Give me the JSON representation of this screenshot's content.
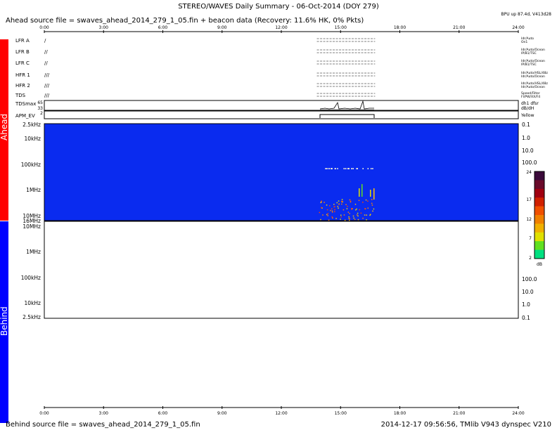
{
  "header": {
    "title": "STEREO/WAVES Daily Summary - 06-Oct-2014 (DOY 279)",
    "ahead_source": "Ahead source file = swaves_ahead_2014_279_1_05.fin + beacon data (Recovery: 11.6% HK,   0% Pkts)",
    "version_tag": "BPU up 87.4d, V413d28"
  },
  "footer": {
    "behind_source": "Behind source file = swaves_ahead_2014_279_1_05.fin",
    "timestamp": "2014-12-17 09:56:56, TMlib V943 dynspec V210"
  },
  "side_labels": {
    "ahead": "Ahead",
    "behind": "Behind",
    "ahead_color": "#ff0000",
    "behind_color": "#0000ff"
  },
  "time_axis": {
    "ticks": [
      "0:00",
      "3:00",
      "6:00",
      "9:00",
      "12:00",
      "15:00",
      "18:00",
      "21:00",
      "24:00"
    ],
    "data_start_hr": 13.8,
    "data_end_hr": 16.75
  },
  "hk_rows": [
    {
      "label": "LFR A",
      "marks": "/",
      "status_right": [
        "Idr/Auto",
        "On1"
      ]
    },
    {
      "label": "LFR B",
      "marks": "//",
      "status_right": [
        "Idr/Auto/Ocean",
        "IP/B1/TSC"
      ]
    },
    {
      "label": "LFR C",
      "marks": "//",
      "status_right": [
        "Idr/Auto/Ocean",
        "IP/B1/TSC"
      ]
    },
    {
      "label": "HFR 1",
      "marks": "///",
      "status_right": [
        "Idr/Auto/HSL/48z",
        "Idr/Auto/Ocean"
      ]
    },
    {
      "label": "HFR 2",
      "marks": "///",
      "status_right": [
        "Idr/Auto/HSL/48z",
        "Idr/Auto/Ocean"
      ]
    },
    {
      "label": "TDS",
      "marks": "///",
      "status_right": [
        "Speed/Filter",
        "Fl/PW/XX/F4"
      ]
    }
  ],
  "tds": {
    "label": "TDSmax",
    "y_ticks": [
      "65",
      "33",
      "0"
    ],
    "status_right": [
      "dh1 dfsr",
      "dB/dH"
    ]
  },
  "apm": {
    "label": "APM_EV",
    "y_tick": "2",
    "status_right": "Yellow"
  },
  "ahead_panel": {
    "freq_labels_left": [
      "2.5kHz",
      "10kHz",
      "100kHz",
      "1MHz",
      "10MHz",
      "16MHz"
    ],
    "freq_labels_right": [
      "0.1",
      "1.0",
      "10.0",
      "100.0"
    ],
    "background_color": "#0a2bef"
  },
  "behind_panel": {
    "freq_labels_left": [
      "10MHz",
      "1MHz",
      "100kHz",
      "10kHz",
      "2.5kHz"
    ],
    "freq_labels_right": [
      "100.0",
      "10.0",
      "1.0",
      "0.1"
    ]
  },
  "colorbar": {
    "ticks": [
      "24",
      "17",
      "12",
      "7",
      "2"
    ],
    "unit": "dB",
    "colors": [
      "#3a0a3a",
      "#6a0a2a",
      "#a00010",
      "#d02000",
      "#f05000",
      "#f08000",
      "#f0b000",
      "#e0e000",
      "#60e020",
      "#00e080"
    ]
  },
  "chart_data": {
    "type": "heatmap",
    "title": "STEREO/WAVES Daily Summary - 06-Oct-2014 (DOY 279)",
    "xlabel": "",
    "ylabel": "",
    "x_range_hours": [
      0,
      24
    ],
    "y_range_freq": [
      "2.5kHz",
      "16MHz"
    ],
    "colorbar_range_db": [
      2,
      24
    ],
    "grid": false
  }
}
